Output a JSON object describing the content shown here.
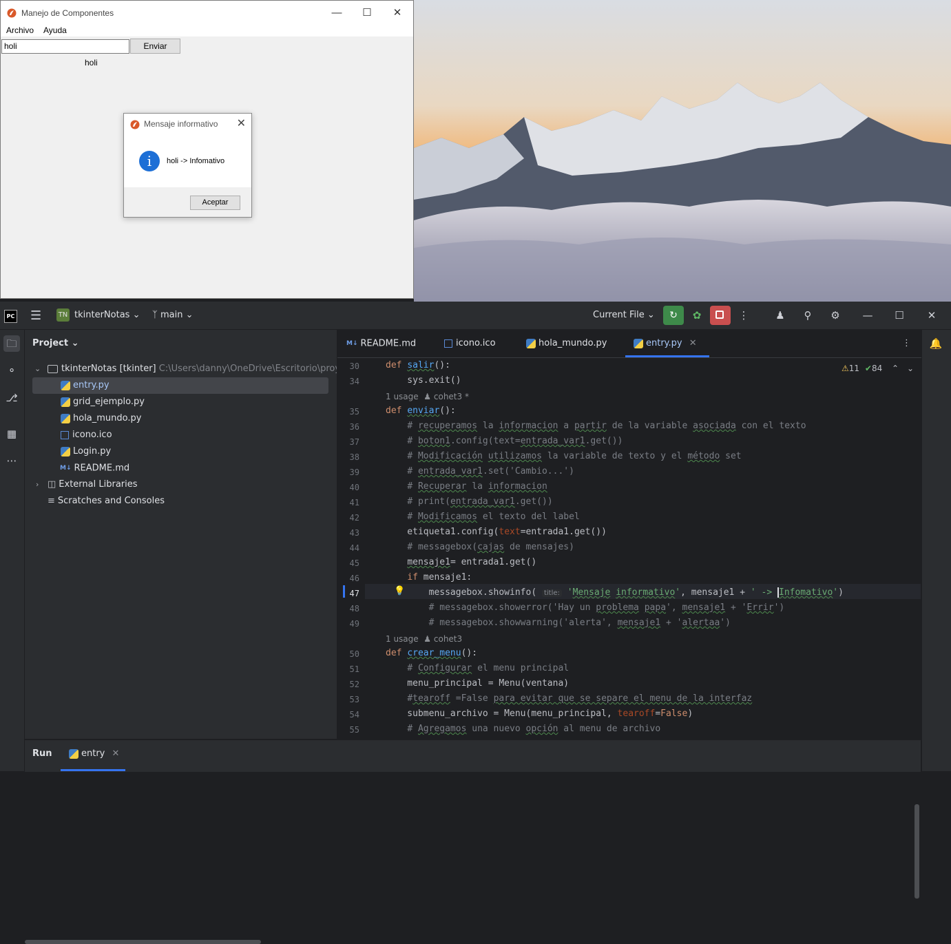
{
  "tk_window": {
    "title": "Manejo de Componentes",
    "menu": [
      "Archivo",
      "Ayuda"
    ],
    "entry_value": "holi",
    "button_label": "Enviar",
    "label_text": "holi"
  },
  "messagebox": {
    "title": "Mensaje informativo",
    "message": "holi -> Infomativo",
    "icon": "info-icon",
    "ok_label": "Aceptar"
  },
  "ide": {
    "project_badge": "TN",
    "project_name": "tkinterNotas",
    "branch": "main",
    "run_config": "Current File",
    "project_panel_title": "Project",
    "tree": {
      "root_name": "tkinterNotas [tkinter]",
      "root_path": "C:\\Users\\danny\\OneDrive\\Escritorio\\proye",
      "files": [
        "entry.py",
        "grid_ejemplo.py",
        "hola_mundo.py",
        "icono.ico",
        "Login.py",
        "README.md"
      ],
      "external_libraries": "External Libraries",
      "scratches": "Scratches and Consoles"
    },
    "tabs": [
      "README.md",
      "icono.ico",
      "hola_mundo.py",
      "entry.py"
    ],
    "active_tab": "entry.py",
    "inspections": {
      "warnings": "11",
      "ok": "84"
    },
    "line_numbers": [
      "30",
      "34",
      "35",
      "36",
      "37",
      "38",
      "39",
      "40",
      "41",
      "42",
      "43",
      "44",
      "45",
      "46",
      "47",
      "48",
      "49",
      "50",
      "51",
      "52",
      "53",
      "54",
      "55"
    ],
    "usages": [
      {
        "count": "1 usage",
        "author": "cohet3 *"
      },
      {
        "count": "1 usage",
        "author": "cohet3"
      }
    ],
    "inlay_hint": "title:",
    "run_panel": {
      "title": "Run",
      "tab": "entry"
    }
  }
}
